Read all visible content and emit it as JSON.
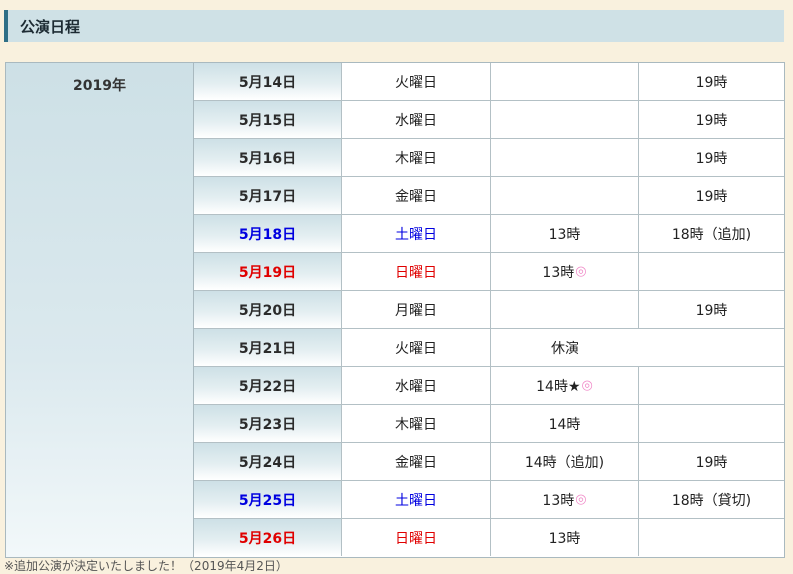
{
  "section_title": "公演日程",
  "year": "2019年",
  "rows": [
    {
      "date": "5月14日",
      "day": "火曜日",
      "a": "",
      "b": "19時",
      "style": ""
    },
    {
      "date": "5月15日",
      "day": "水曜日",
      "a": "",
      "b": "19時",
      "style": ""
    },
    {
      "date": "5月16日",
      "day": "木曜日",
      "a": "",
      "b": "19時",
      "style": ""
    },
    {
      "date": "5月17日",
      "day": "金曜日",
      "a": "",
      "b": "19時",
      "style": ""
    },
    {
      "date": "5月18日",
      "day": "土曜日",
      "a": "13時",
      "b": "18時（追加)",
      "style": "blue"
    },
    {
      "date": "5月19日",
      "day": "日曜日",
      "a": "13時",
      "mark": "◎",
      "b": "",
      "style": "red"
    },
    {
      "date": "5月20日",
      "day": "月曜日",
      "a": "",
      "b": "19時",
      "style": ""
    },
    {
      "date": "5月21日",
      "day": "火曜日",
      "merged": "休演",
      "style": ""
    },
    {
      "date": "5月22日",
      "day": "水曜日",
      "a": "14時★",
      "mark": "◎",
      "b": "",
      "style": ""
    },
    {
      "date": "5月23日",
      "day": "木曜日",
      "a": "14時",
      "b": "",
      "style": ""
    },
    {
      "date": "5月24日",
      "day": "金曜日",
      "a": "14時（追加)",
      "b": "19時",
      "style": "boldday"
    },
    {
      "date": "5月25日",
      "day": "土曜日",
      "a": "13時",
      "mark": "◎",
      "b": "18時（貸切)",
      "style": "blue"
    },
    {
      "date": "5月26日",
      "day": "日曜日",
      "a": "13時",
      "b": "",
      "style": "red"
    }
  ],
  "footer_note": "※追加公演が決定いたしました！（2019年4月2日）",
  "colors": {
    "saturday": "#0000e0",
    "sunday": "#e00000",
    "accent": "#2f6f86"
  }
}
